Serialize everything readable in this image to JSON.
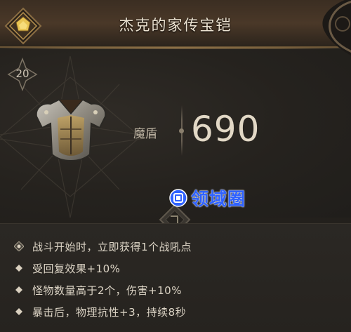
{
  "item": {
    "name": "杰克的家传宝铠",
    "level": "20",
    "stat_label": "魔盾",
    "stat_value": "690"
  },
  "watermark": {
    "text": "领域圈"
  },
  "effects": [
    {
      "text": "战斗开始时，立即获得1个战吼点",
      "bullet": "shout-icon"
    },
    {
      "text": "受回复效果+10%",
      "bullet": "diamond-icon"
    },
    {
      "text": "怪物数量高于2个，伤害+10%",
      "bullet": "diamond-icon"
    },
    {
      "text": "暴击后，物理抗性+3，持续8秒",
      "bullet": "diamond-icon"
    }
  ],
  "colors": {
    "header_bg": "#4a3828",
    "emblem_gold": "#d9b24a",
    "text_primary": "#ece3d2",
    "watermark_blue": "#2f62ff"
  }
}
